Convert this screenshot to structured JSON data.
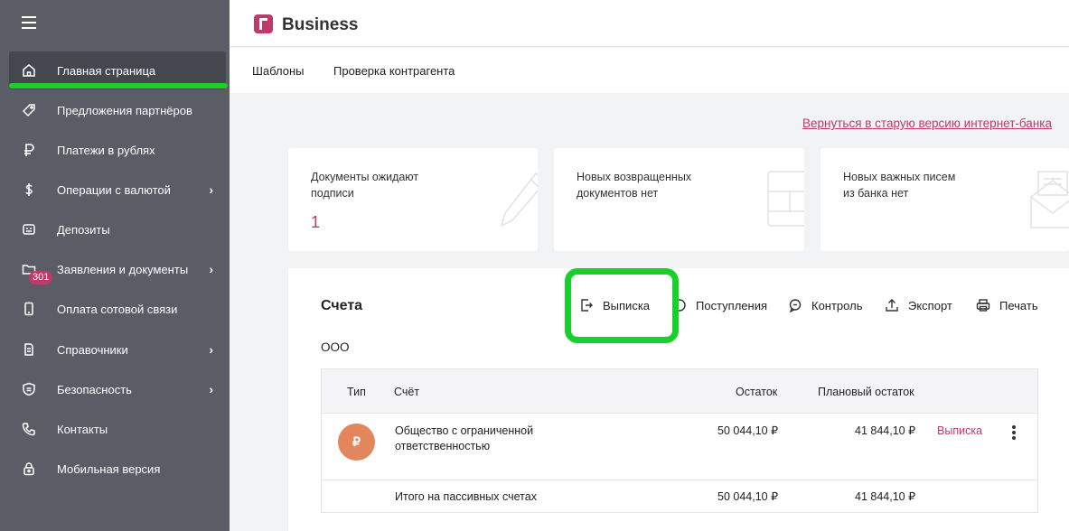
{
  "sidebar": {
    "items": [
      {
        "label": "Главная страница",
        "icon": "home-icon"
      },
      {
        "label": "Предложения партнёров",
        "icon": "tag-icon"
      },
      {
        "label": "Платежи в рублях",
        "icon": "ruble-icon"
      },
      {
        "label": "Операции с валютой",
        "icon": "dollar-icon",
        "has_children": true
      },
      {
        "label": "Депозиты",
        "icon": "deposit-icon"
      },
      {
        "label": "Заявления и документы",
        "icon": "folder-icon",
        "has_children": true,
        "badge": "301"
      },
      {
        "label": "Оплата сотовой связи",
        "icon": "phone-icon"
      },
      {
        "label": "Справочники",
        "icon": "book-icon",
        "has_children": true
      },
      {
        "label": "Безопасность",
        "icon": "shield-icon",
        "has_children": true
      },
      {
        "label": "Контакты",
        "icon": "call-icon"
      },
      {
        "label": "Мобильная версия",
        "icon": "lock-icon"
      }
    ],
    "active_index": 0
  },
  "header": {
    "brand": "Business"
  },
  "subnav": {
    "tabs": [
      "Шаблоны",
      "Проверка контрагента"
    ]
  },
  "old_version_link": "Вернуться в старую версию интернет-банка",
  "cards": [
    {
      "text_line1": "Документы ожидают",
      "text_line2": "подписи",
      "value": "1",
      "icon": "pen-icon"
    },
    {
      "text_line1": "Новых возвращенных",
      "text_line2": "документов нет",
      "icon": "document-icon"
    },
    {
      "text_line1": "Новых важных писем",
      "text_line2": "из банка нет",
      "icon": "envelope-icon"
    }
  ],
  "accounts": {
    "title": "Счета",
    "org": "ООО",
    "actions": {
      "statement": "Выписка",
      "income": "Поступления",
      "control": "Контроль",
      "export": "Экспорт",
      "print": "Печать"
    },
    "columns": {
      "type": "Тип",
      "account": "Счёт",
      "balance": "Остаток",
      "planned": "Плановый остаток"
    },
    "rows": [
      {
        "type_symbol": "₽",
        "name_line1": "Общество с ограниченной",
        "name_line2": "ответственностью",
        "balance": "50 044,10 ₽",
        "planned": "41 844,10 ₽",
        "link": "Выписка"
      }
    ],
    "total": {
      "label": "Итого на пассивных счетах",
      "balance": "50 044,10 ₽",
      "planned": "41 844,10 ₽"
    }
  }
}
